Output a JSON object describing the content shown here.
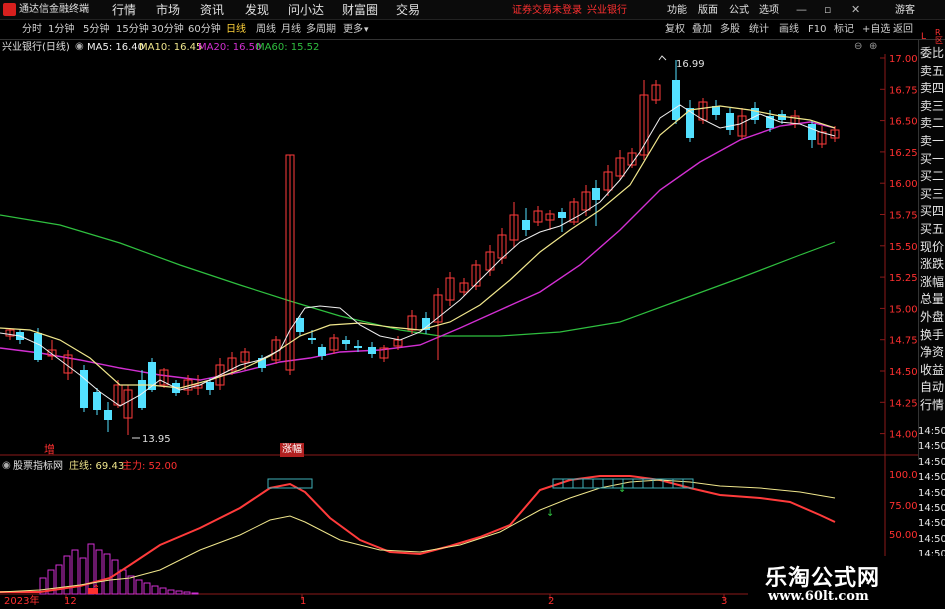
{
  "titlebar": {
    "app_title": "通达信金融终端",
    "menu": [
      "行情",
      "市场",
      "资讯",
      "发现",
      "问小达",
      "财富圈",
      "交易"
    ],
    "notice": "证券交易未登录",
    "stock_name": "兴业银行",
    "right_menu": [
      "功能",
      "版面",
      "公式",
      "选项"
    ],
    "guest": "游客"
  },
  "toolbar": {
    "periods": [
      "分时",
      "1分钟",
      "5分钟",
      "15分钟",
      "30分钟",
      "60分钟",
      "日线",
      "周线",
      "月线",
      "多周期",
      "更多"
    ],
    "active_period": "日线",
    "right_tools": [
      "复权",
      "叠加",
      "多股",
      "统计",
      "画线",
      "F10",
      "标记",
      "+自选",
      "返回"
    ]
  },
  "info": {
    "stock": "兴业银行(日线)",
    "ma5": "MA5: 16.40",
    "ma10": "MA10: 16.45",
    "ma20": "MA20: 16.50",
    "ma60": "MA60: 15.52"
  },
  "price_axis": [
    "17.00",
    "16.75",
    "16.50",
    "16.25",
    "16.00",
    "15.75",
    "15.50",
    "15.25",
    "15.00",
    "14.75",
    "14.50",
    "14.25",
    "14.00"
  ],
  "annotations": {
    "high": "16.99",
    "low": "13.95",
    "label1": "增",
    "label2": "涨幅"
  },
  "right_side": [
    "委比",
    "卖五",
    "卖四",
    "卖三",
    "卖二",
    "卖一",
    "买一",
    "买二",
    "买三",
    "买四",
    "买五",
    "现价",
    "涨跌",
    "涨幅",
    "总量",
    "外盘",
    "换手",
    "净资",
    "收益",
    "自动",
    "行情"
  ],
  "right_side_corner": {
    "top": "L",
    "r": "R",
    "sub": "区"
  },
  "right_cut_numbers": [
    "14:50",
    "14:50",
    "14:50",
    "14:50",
    "14:50",
    "14:50",
    "14:50",
    "14:50",
    "14:50",
    "14:50",
    "14:50"
  ],
  "indicator": {
    "name": "股票指标网",
    "line1": "庄线: 69.43",
    "line2": "主力: 52.00",
    "axis": [
      "100.0",
      "75.00",
      "50.00"
    ]
  },
  "date_axis": [
    "2023年",
    "12",
    "1",
    "2",
    "3"
  ],
  "watermark": {
    "title": "乐淘公式网",
    "url": "www.60lt.com"
  },
  "colors": {
    "up": "#ff3b3b",
    "down": "#53e0ff",
    "ma5": "#f0f0f0",
    "ma10": "#f0e68c",
    "ma20": "#d22fd2",
    "ma60": "#2fbf3f",
    "accent": "#ff2020"
  }
}
